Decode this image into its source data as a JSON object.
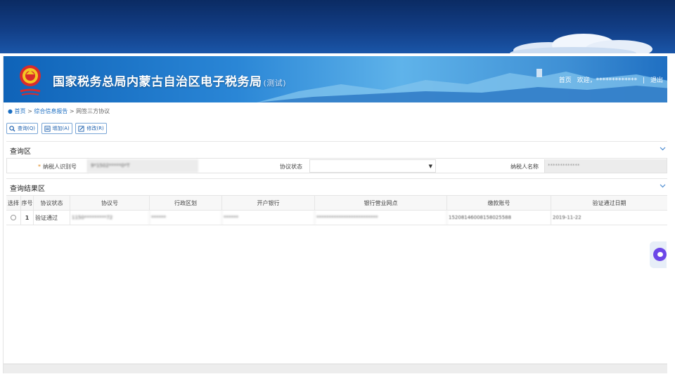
{
  "header": {
    "title": "国家税务总局内蒙古自治区电子税务局",
    "title_suffix": "(测试)",
    "home_link": "首页",
    "welcome": "欢迎，*************",
    "separator": "|",
    "logout": "退出",
    "emblem_icon": "tax-emblem-icon"
  },
  "breadcrumb": {
    "home": "首页",
    "sep1": ">",
    "level2": "综合信息报告",
    "sep2": ">",
    "current": "网签三方协议"
  },
  "toolbar": {
    "query_label": "查询(Q)",
    "add_label": "增加(A)",
    "edit_label": "修改(R)"
  },
  "query_section": {
    "title": "查询区",
    "required_mark": "*",
    "taxpayer_id_label": "纳税人识别号",
    "taxpayer_id_value": "9*1502*****0*T",
    "status_label": "协议状态",
    "status_value": "",
    "taxpayer_name_label": "纳税人名称",
    "taxpayer_name_value": "*************"
  },
  "result_section": {
    "title": "查询结果区",
    "columns": [
      "选择",
      "序号",
      "协议状态",
      "协议号",
      "行政区划",
      "开户银行",
      "银行营业网点",
      "缴款账号",
      "验证通过日期"
    ],
    "rows": [
      {
        "index": "1",
        "status": "验证通过",
        "agreement_no": "1150*********72",
        "region": "******",
        "bank": "******",
        "branch": "*************************",
        "account": "15208146008158025588",
        "verify_date": "2019-11-22"
      }
    ]
  },
  "colors": {
    "top_bar": "#123e86",
    "banner": "#2a86d6",
    "link": "#1b6ec2",
    "required": "#e08a1e"
  }
}
